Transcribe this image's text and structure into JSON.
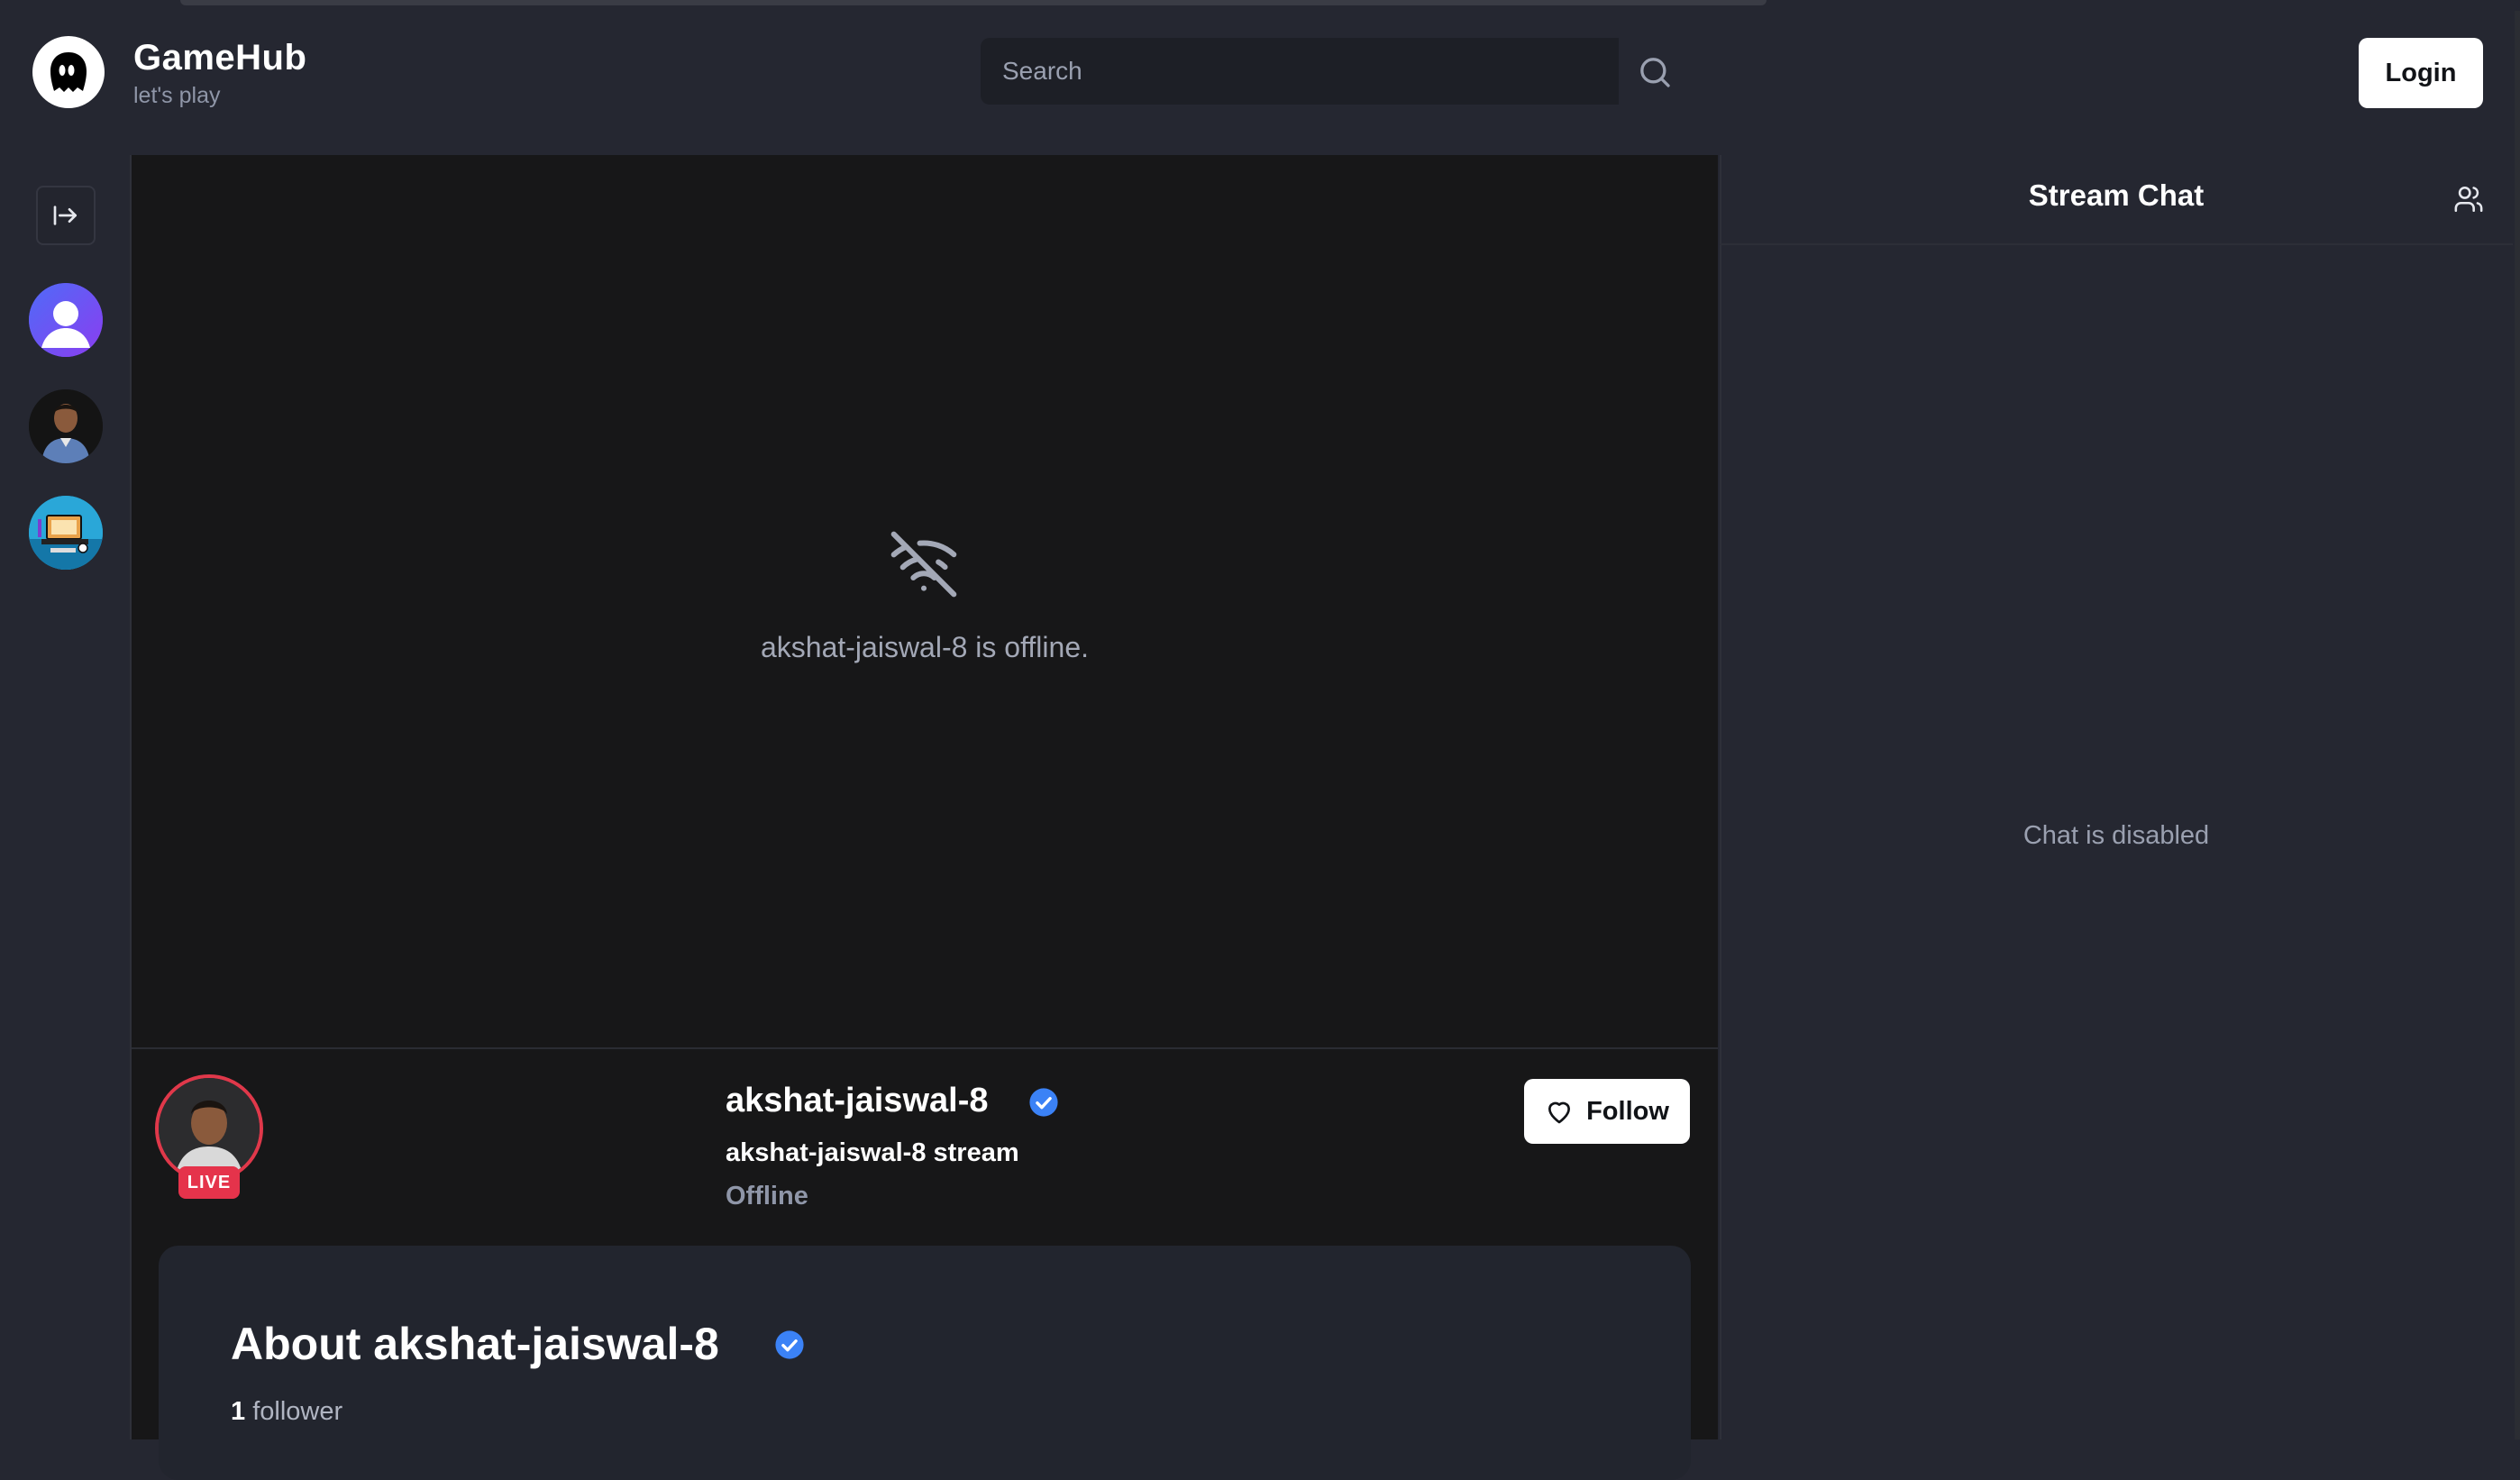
{
  "brand": {
    "name": "GameHub",
    "tagline": "let's play",
    "logo_icon": "ghost-icon"
  },
  "search": {
    "placeholder": "Search",
    "value": "",
    "icon": "search-icon"
  },
  "auth": {
    "login_label": "Login"
  },
  "sidebar": {
    "expand_icon": "arrow-right-to-line-icon",
    "avatars": [
      {
        "name": "default-user-avatar",
        "color": "#6a4cf5"
      },
      {
        "name": "akshat-avatar",
        "color": "#2a2a2a"
      },
      {
        "name": "desk-setup-avatar",
        "color": "#1e9ecf"
      }
    ]
  },
  "player": {
    "status_icon": "wifi-off-icon",
    "offline_message": "akshat-jaiswal-8 is offline."
  },
  "stream_info": {
    "host_name": "akshat-jaiswal-8",
    "stream_name": "akshat-jaiswal-8 stream",
    "status": "Offline",
    "live_badge": "LIVE",
    "follow_label": "Follow",
    "verified_color": "#3b82f6"
  },
  "about": {
    "title": "About akshat-jaiswal-8",
    "follower_count": "1",
    "follower_label": "follower"
  },
  "chat": {
    "title": "Stream Chat",
    "disabled_message": "Chat is disabled",
    "community_icon": "users-icon"
  },
  "colors": {
    "background": "#252731",
    "player_bg": "#171718",
    "live_red": "#e5334b",
    "accent_blue": "#3b82f6"
  }
}
